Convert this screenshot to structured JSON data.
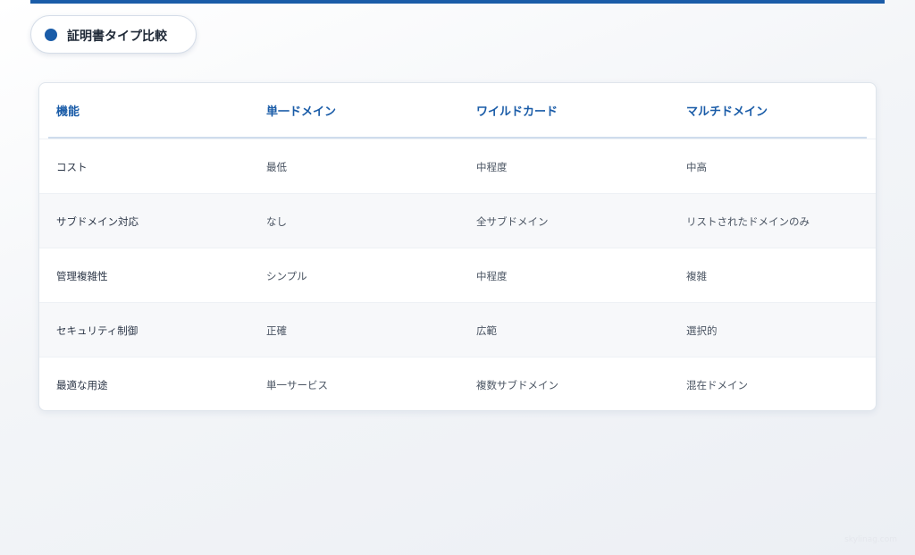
{
  "header": {
    "title": "証明書タイプ比較"
  },
  "table": {
    "columns": [
      "機能",
      "単一ドメイン",
      "ワイルドカード",
      "マルチドメイン"
    ],
    "rows": [
      [
        "コスト",
        "最低",
        "中程度",
        "中高"
      ],
      [
        "サブドメイン対応",
        "なし",
        "全サブドメイン",
        "リストされたドメインのみ"
      ],
      [
        "管理複雑性",
        "シンプル",
        "中程度",
        "複雑"
      ],
      [
        "セキュリティ制御",
        "正確",
        "広範",
        "選択的"
      ],
      [
        "最適な用途",
        "単一サービス",
        "複数サブドメイン",
        "混在ドメイン"
      ]
    ]
  },
  "watermark": "skylinag.com",
  "colors": {
    "accent": "#1a5ca8",
    "header_text": "#1a5ca8",
    "row_alt": "#f7f8fa"
  }
}
